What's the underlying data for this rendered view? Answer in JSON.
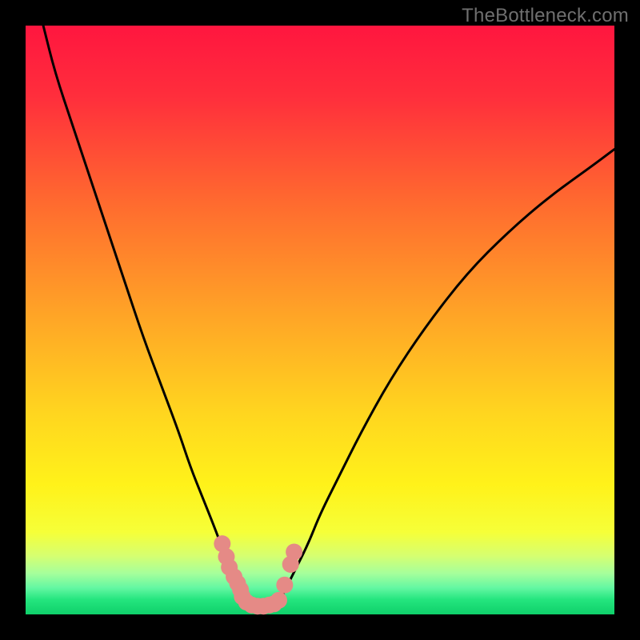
{
  "watermark": "TheBottleneck.com",
  "chart_data": {
    "type": "line",
    "title": "",
    "xlabel": "",
    "ylabel": "",
    "xlim": [
      0,
      100
    ],
    "ylim": [
      0,
      100
    ],
    "grid": false,
    "legend": false,
    "background_gradient_stops": [
      {
        "offset": 0.0,
        "color": "#ff163f"
      },
      {
        "offset": 0.12,
        "color": "#ff2e3c"
      },
      {
        "offset": 0.3,
        "color": "#ff6a2f"
      },
      {
        "offset": 0.5,
        "color": "#ffa726"
      },
      {
        "offset": 0.66,
        "color": "#ffd61f"
      },
      {
        "offset": 0.78,
        "color": "#fff21a"
      },
      {
        "offset": 0.86,
        "color": "#f6ff38"
      },
      {
        "offset": 0.9,
        "color": "#d6ff70"
      },
      {
        "offset": 0.93,
        "color": "#a6ff9b"
      },
      {
        "offset": 0.955,
        "color": "#63f7a2"
      },
      {
        "offset": 0.975,
        "color": "#24e57e"
      },
      {
        "offset": 1.0,
        "color": "#0fd06a"
      }
    ],
    "series": [
      {
        "name": "left-curve",
        "x": [
          3,
          5,
          8,
          11,
          14,
          17,
          20,
          23,
          26,
          28,
          30,
          32,
          33.5,
          35,
          36.5,
          38
        ],
        "y": [
          100,
          92,
          83,
          74,
          65,
          56,
          47,
          39,
          31,
          25,
          20,
          15,
          11,
          8,
          5,
          2
        ]
      },
      {
        "name": "right-curve",
        "x": [
          43,
          44.5,
          46,
          48,
          50,
          53,
          57,
          62,
          68,
          75,
          82,
          89,
          96,
          100
        ],
        "y": [
          2,
          5,
          8,
          12,
          17,
          23,
          31,
          40,
          49,
          58,
          65,
          71,
          76,
          79
        ]
      },
      {
        "name": "flat-bottom",
        "x": [
          38,
          43
        ],
        "y": [
          1.5,
          1.5
        ]
      }
    ],
    "markers": {
      "name": "data-points",
      "color": "#e58a86",
      "points": [
        {
          "x": 33.4,
          "y": 12.0
        },
        {
          "x": 34.1,
          "y": 9.8
        },
        {
          "x": 34.6,
          "y": 8.0
        },
        {
          "x": 35.4,
          "y": 6.4
        },
        {
          "x": 36.0,
          "y": 5.3
        },
        {
          "x": 36.5,
          "y": 4.2
        },
        {
          "x": 36.8,
          "y": 3.0
        },
        {
          "x": 37.5,
          "y": 2.1
        },
        {
          "x": 38.4,
          "y": 1.6
        },
        {
          "x": 39.4,
          "y": 1.4
        },
        {
          "x": 40.4,
          "y": 1.4
        },
        {
          "x": 41.4,
          "y": 1.6
        },
        {
          "x": 42.2,
          "y": 1.8
        },
        {
          "x": 43.0,
          "y": 2.4
        },
        {
          "x": 44.0,
          "y": 5.0
        },
        {
          "x": 45.0,
          "y": 8.5
        },
        {
          "x": 45.6,
          "y": 10.6
        }
      ]
    }
  }
}
